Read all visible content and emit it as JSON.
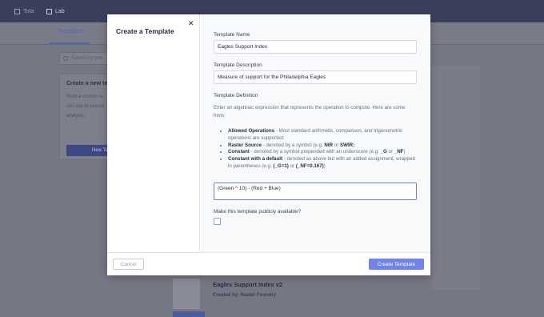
{
  "topbar": {
    "nav": [
      {
        "label": "Tota",
        "icon": "square-icon"
      },
      {
        "label": "Lab",
        "icon": "lab-icon"
      }
    ]
  },
  "background": {
    "tab_label": "Templates",
    "search_placeholder": "Search for tem",
    "card": {
      "title": "Create a new tem",
      "text": "Build a custom te\ncan use to execut\nanalysis.",
      "button_label": "New Te"
    },
    "item": {
      "title": "Eagles Support Index v2",
      "subtitle": "Created by: Raster Foundry"
    }
  },
  "modal": {
    "title": "Create a Template",
    "close_icon": "close-icon",
    "name_label": "Template Name",
    "name_value": "Eagles Support Index",
    "description_label": "Template Description",
    "description_value": "Measure of support for the Philadelphia Eagles",
    "definition_label": "Template Definition",
    "definition_hint": "Enter an algebraic expression that represents the operation to compute. Here are some hints:",
    "hints": [
      {
        "bold": "Allowed Operations",
        "text": " - Most standard arithmetic, comparison, and trigonometric operations are supported."
      },
      {
        "bold": "Raster Source",
        "text": " - denoted by a symbol (e.g. ",
        "b1": "NIR",
        "mid": " or ",
        "b2": "SWIR",
        "end": ")"
      },
      {
        "bold": "Constant",
        "text": " - denoted by a symbol prepended with an underscore (e.g. ",
        "b1": "_G",
        "mid": " or ",
        "b2": "_NF",
        "end": ")"
      },
      {
        "bold": "Constant with a default",
        "text": " - denoted as above but with an added assignment, wrapped in parentheses (e.g. ",
        "b1": "(_G=1)",
        "mid": " or ",
        "b2": "(_NF=0.167)",
        "end": ")"
      }
    ],
    "expression_value": "(Green ^ 10) - (Red + Blue)",
    "public_label": "Make this template publicly available?",
    "public_checked": false,
    "cancel_label": "Cancel",
    "create_label": "Create Template"
  },
  "colors": {
    "accent": "#6f82f2",
    "topbar": "#3a3f5c"
  }
}
